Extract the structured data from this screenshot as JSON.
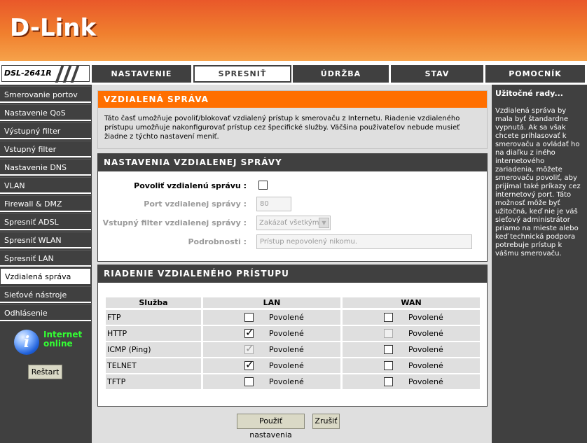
{
  "brand": {
    "logo": "D-Link",
    "model": "DSL-2641R"
  },
  "nav": {
    "tabs": [
      {
        "label": "NASTAVENIE"
      },
      {
        "label": "SPRESNIŤ"
      },
      {
        "label": "ÚDRŽBA"
      },
      {
        "label": "STAV"
      },
      {
        "label": "POMOCNÍK"
      }
    ],
    "active": "SPRESNIŤ"
  },
  "sidebar": {
    "items": [
      {
        "label": "Smerovanie portov"
      },
      {
        "label": "Nastavenie QoS"
      },
      {
        "label": "Výstupný filter"
      },
      {
        "label": "Vstupný filter"
      },
      {
        "label": "Nastavenie DNS"
      },
      {
        "label": "VLAN"
      },
      {
        "label": "Firewall & DMZ"
      },
      {
        "label": "Spresniť ADSL"
      },
      {
        "label": "Spresniť WLAN"
      },
      {
        "label": "Spresniť LAN"
      },
      {
        "label": "Vzdialená správa"
      },
      {
        "label": "Sieťové nástroje"
      },
      {
        "label": "Odhlásenie"
      }
    ],
    "active": "Vzdialená správa",
    "status_line1": "Internet",
    "status_line2": "online",
    "status_icon": "info-icon",
    "reboot_label": "Reštart"
  },
  "intro": {
    "title": "VZDIALENÁ SPRÁVA",
    "text": "Táto časť umožňuje povoliť/blokovať vzdialený prístup k smerovaču z Internetu. Riadenie vzdialeného prístupu umožňuje nakonfigurovať prístup cez špecifické služby. Väčšina používateľov nebude musieť žiadne z týchto nastavení meniť."
  },
  "settings": {
    "title": "NASTAVENIA VZDIALENEJ SPRÁVY",
    "enable_label": "Povoliť vzdialenú správu :",
    "enable_checked": false,
    "port_label": "Port vzdialenej správy :",
    "port_value": "80",
    "filter_label": "Vstupný filter vzdialenej správy :",
    "filter_value": "Zakázať všetkým",
    "details_label": "Podrobnosti :",
    "details_value": "Prístup nepovolený nikomu."
  },
  "access": {
    "title": "RIADENIE VZDIALENÉHO PRÍSTUPU",
    "columns": [
      "Služba",
      "LAN",
      "WAN"
    ],
    "allowed_label": "Povolené",
    "rows": [
      {
        "service": "FTP",
        "lan_checked": false,
        "lan_disabled": false,
        "wan_checked": false,
        "wan_disabled": false
      },
      {
        "service": "HTTP",
        "lan_checked": true,
        "lan_disabled": false,
        "wan_checked": false,
        "wan_disabled": true
      },
      {
        "service": "ICMP (Ping)",
        "lan_checked": true,
        "lan_disabled": true,
        "wan_checked": false,
        "wan_disabled": false
      },
      {
        "service": "TELNET",
        "lan_checked": true,
        "lan_disabled": false,
        "wan_checked": false,
        "wan_disabled": false
      },
      {
        "service": "TFTP",
        "lan_checked": false,
        "lan_disabled": false,
        "wan_checked": false,
        "wan_disabled": false
      }
    ]
  },
  "actions": {
    "apply_label": "Použiť nastavenia",
    "cancel_label": "Zrušiť"
  },
  "help": {
    "title": "Užitočné rady...",
    "text": "Vzdialená správa by mala byť štandardne vypnutá. Ak sa však chcete prihlasovať k smerovaču a ovládať ho na diaľku z iného internetového zariadenia, môžete smerovaču povoliť, aby prijímal také príkazy cez internetový port. Táto možnosť môže byť užitočná, keď nie je váš sieťový administrátor priamo na mieste alebo keď technická podpora potrebuje prístup k vášmu smerovaču."
  },
  "colors": {
    "accent": "#ff6f00",
    "dark": "#404040",
    "header": "#f07f2e",
    "online": "#33ff33"
  }
}
